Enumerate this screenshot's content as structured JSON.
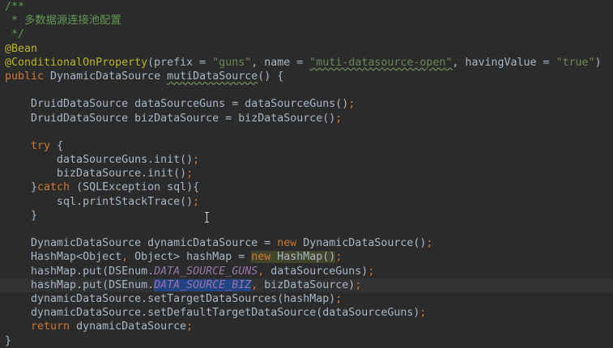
{
  "editor": {
    "colors": {
      "background": "#2b2b2b",
      "text": "#a9b7c6",
      "keyword": "#cc7832",
      "string": "#6a8759",
      "annotation": "#bbb529",
      "doc_comment": "#629755",
      "constant": "#9876aa",
      "selection": "#214283"
    },
    "current_line": 20,
    "lines": [
      [
        [
          "/**",
          "doc"
        ]
      ],
      [
        [
          " * 多数据源连接池配置",
          "doc"
        ]
      ],
      [
        [
          " */",
          "doc"
        ]
      ],
      [
        [
          "@Bean",
          "ann"
        ]
      ],
      [
        [
          "@ConditionalOnProperty",
          "ann"
        ],
        [
          "(prefix = ",
          ""
        ],
        [
          "\"guns\"",
          "str"
        ],
        [
          ", name = ",
          ""
        ],
        [
          "\"muti-datasource-open\"",
          "str warn"
        ],
        [
          ", havingValue = ",
          ""
        ],
        [
          "\"true\"",
          "str"
        ],
        [
          ")",
          ""
        ]
      ],
      [
        [
          "public ",
          "kw"
        ],
        [
          "DynamicDataSource ",
          ""
        ],
        [
          "mutiDataSource",
          "warn"
        ],
        [
          "() {",
          ""
        ]
      ],
      [],
      [
        [
          "    DruidDataSource dataSourceGuns = dataSourceGuns()",
          ""
        ],
        [
          ";",
          "kw"
        ]
      ],
      [
        [
          "    DruidDataSource bizDataSource = bizDataSource()",
          ""
        ],
        [
          ";",
          "kw"
        ]
      ],
      [],
      [
        [
          "    ",
          ""
        ],
        [
          "try ",
          "kw"
        ],
        [
          "{",
          ""
        ]
      ],
      [
        [
          "        dataSourceGuns.init()",
          ""
        ],
        [
          ";",
          "kw"
        ]
      ],
      [
        [
          "        bizDataSource.init()",
          ""
        ],
        [
          ";",
          "kw"
        ]
      ],
      [
        [
          "    }",
          ""
        ],
        [
          "catch ",
          "kw"
        ],
        [
          "(SQLException sql){",
          ""
        ]
      ],
      [
        [
          "        sql.printStackTrace()",
          ""
        ],
        [
          ";",
          "kw"
        ]
      ],
      [
        [
          "    }",
          ""
        ]
      ],
      [],
      [
        [
          "    DynamicDataSource dynamicDataSource = ",
          ""
        ],
        [
          "new ",
          "kw"
        ],
        [
          "DynamicDataSource()",
          ""
        ],
        [
          ";",
          "kw"
        ]
      ],
      [
        [
          "    HashMap<Object",
          ""
        ],
        [
          ", ",
          "kw"
        ],
        [
          "Object> hashMap = ",
          ""
        ],
        [
          "new ",
          "kw hl"
        ],
        [
          "HashMap()",
          "hl"
        ],
        [
          ";",
          "kw"
        ]
      ],
      [
        [
          "    hashMap.put(DSEnum.",
          ""
        ],
        [
          "DATA_SOURCE_GUNS",
          "const"
        ],
        [
          ", ",
          "kw"
        ],
        [
          "dataSourceGuns)",
          ""
        ],
        [
          ";",
          "kw"
        ]
      ],
      [
        [
          "    hashMap.put(DSEnum.",
          ""
        ],
        [
          "DATA_SOURCE_BIZ",
          "const sel"
        ],
        [
          ", ",
          "kw"
        ],
        [
          "bizDataSource)",
          ""
        ],
        [
          ";",
          "kw"
        ]
      ],
      [
        [
          "    dynamicDataSource.setTargetDataSources(hashMap)",
          ""
        ],
        [
          ";",
          "kw"
        ]
      ],
      [
        [
          "    dynamicDataSource.setDefaultTargetDataSource(dataSourceGuns)",
          ""
        ],
        [
          ";",
          "kw"
        ]
      ],
      [
        [
          "    ",
          ""
        ],
        [
          "return ",
          "kw"
        ],
        [
          "dynamicDataSource",
          ""
        ],
        [
          ";",
          "kw"
        ]
      ],
      [
        [
          "}",
          ""
        ]
      ]
    ]
  }
}
